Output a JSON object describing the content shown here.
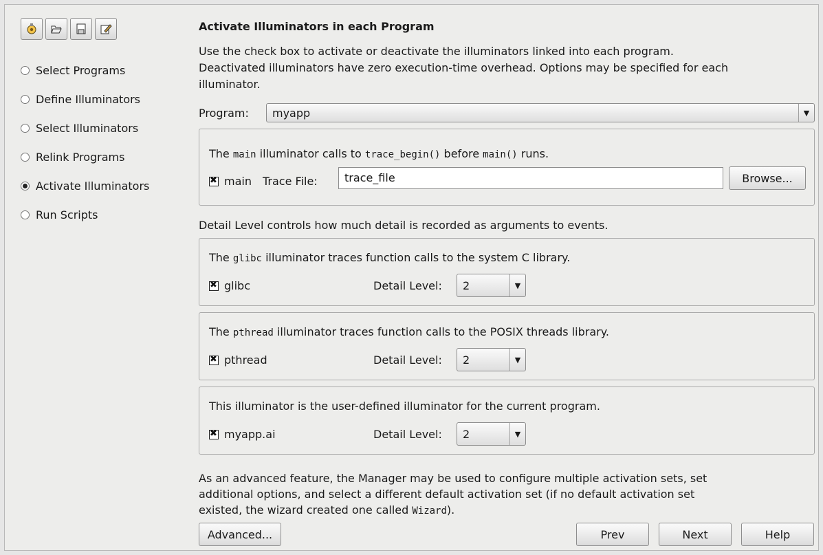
{
  "toolbar": {
    "icons": [
      "settings-icon",
      "open-folder-icon",
      "save-icon",
      "edit-icon"
    ]
  },
  "nav": {
    "items": [
      {
        "label": "Select Programs",
        "selected": false
      },
      {
        "label": "Define Illuminators",
        "selected": false
      },
      {
        "label": "Select Illuminators",
        "selected": false
      },
      {
        "label": "Relink Programs",
        "selected": false
      },
      {
        "label": "Activate Illuminators",
        "selected": true
      },
      {
        "label": "Run Scripts",
        "selected": false
      }
    ]
  },
  "main": {
    "title": "Activate Illuminators in each Program",
    "description_lines": [
      "Use the check box to activate or deactivate the illuminators linked into each program.",
      "Deactivated illuminators have zero execution-time overhead. Options may be specified for each",
      "illuminator."
    ],
    "program": {
      "label": "Program:",
      "value": "myapp"
    },
    "main_group": {
      "t1": "The ",
      "code1": "main",
      "t2": " illuminator calls to ",
      "code2": "trace_begin()",
      "t3": " before ",
      "code3": "main()",
      "t4": " runs.",
      "checkbox_label": "main",
      "checked": true,
      "trace_file_label": "Trace File:",
      "trace_file_value": "trace_file",
      "browse_label": "Browse..."
    },
    "detail_intro": "Detail Level controls how much detail is recorded as arguments to events.",
    "illuminators": [
      {
        "pre": "The ",
        "code": "glibc",
        "post": " illuminator traces function calls to the system C library.",
        "name": "glibc",
        "checked": true,
        "detail_label": "Detail Level:",
        "detail_value": "2"
      },
      {
        "pre": "The ",
        "code": "pthread",
        "post": " illuminator traces function calls to the POSIX threads library.",
        "name": "pthread",
        "checked": true,
        "detail_label": "Detail Level:",
        "detail_value": "2"
      },
      {
        "pre": "This illuminator is the user-defined illuminator for the current program.",
        "code": "",
        "post": "",
        "name": "myapp.ai",
        "checked": true,
        "detail_label": "Detail Level:",
        "detail_value": "2"
      }
    ],
    "advanced_text": {
      "line1": "As an advanced feature, the Manager may be used to configure multiple activation sets, set",
      "line2": "additional options, and select a different default activation set (if no default activation set",
      "line3_pre": "existed, the wizard created one called ",
      "line3_code": "Wizard",
      "line3_post": ")."
    },
    "buttons": {
      "advanced": "Advanced...",
      "prev": "Prev",
      "next": "Next",
      "help": "Help"
    }
  }
}
